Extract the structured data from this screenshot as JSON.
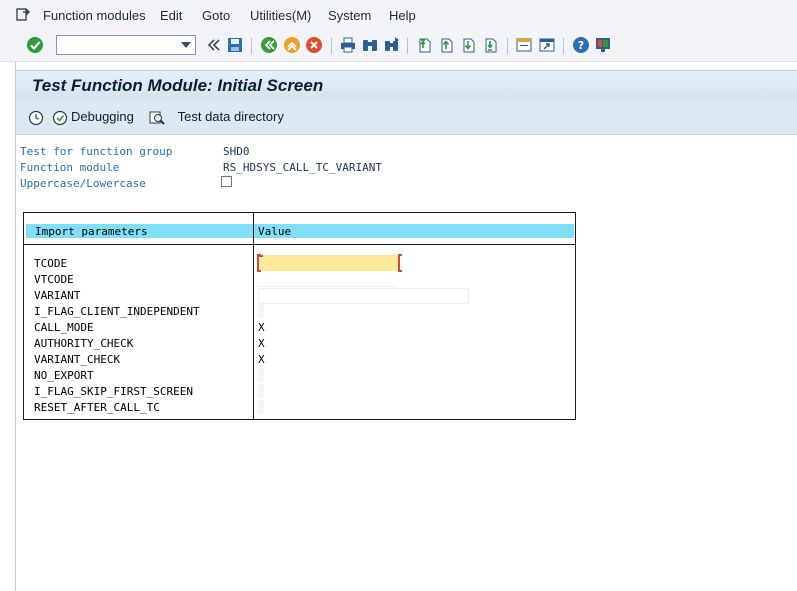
{
  "menubar": {
    "items": [
      "Function modules",
      "Edit",
      "Goto",
      "Utilities(M)",
      "System",
      "Help"
    ]
  },
  "toolbar": {
    "command_field_value": "",
    "icons": [
      "enter-check-icon",
      "back-icon",
      "save-icon",
      "back-green-icon",
      "exit-icon",
      "cancel-icon",
      "print-icon",
      "find-icon",
      "find-next-icon",
      "first-page-icon",
      "previous-page-icon",
      "next-page-icon",
      "last-page-icon",
      "create-session-icon",
      "shortcut-icon",
      "help-icon",
      "layout-icon"
    ]
  },
  "page": {
    "title": "Test Function Module: Initial Screen"
  },
  "app_toolbar": {
    "debugging_label": "Debugging",
    "test_data_label": "Test data directory"
  },
  "fields": {
    "group_label": "Test for function group",
    "group_value": "SHD0",
    "module_label": "Function module",
    "module_value": "RS_HDSYS_CALL_TC_VARIANT",
    "case_label": "Uppercase/Lowercase",
    "case_checked": false
  },
  "params_table": {
    "col_name_header": "Import parameters",
    "col_value_header": "Value",
    "rows": [
      {
        "name": "TCODE",
        "value": ""
      },
      {
        "name": "VTCODE",
        "value": ""
      },
      {
        "name": "VARIANT",
        "value": ""
      },
      {
        "name": "I_FLAG_CLIENT_INDEPENDENT",
        "value": ""
      },
      {
        "name": "CALL_MODE",
        "value": "X"
      },
      {
        "name": "AUTHORITY_CHECK",
        "value": "X"
      },
      {
        "name": "VARIANT_CHECK",
        "value": "X"
      },
      {
        "name": "NO_EXPORT",
        "value": ""
      },
      {
        "name": "I_FLAG_SKIP_FIRST_SCREEN",
        "value": ""
      },
      {
        "name": "RESET_AFTER_CALL_TC",
        "value": ""
      }
    ]
  },
  "colors": {
    "header_band": "#80dff7",
    "focus_field": "#fde99a",
    "label_blue": "#2a6fa8",
    "title_bg": "#d5e3ee"
  }
}
